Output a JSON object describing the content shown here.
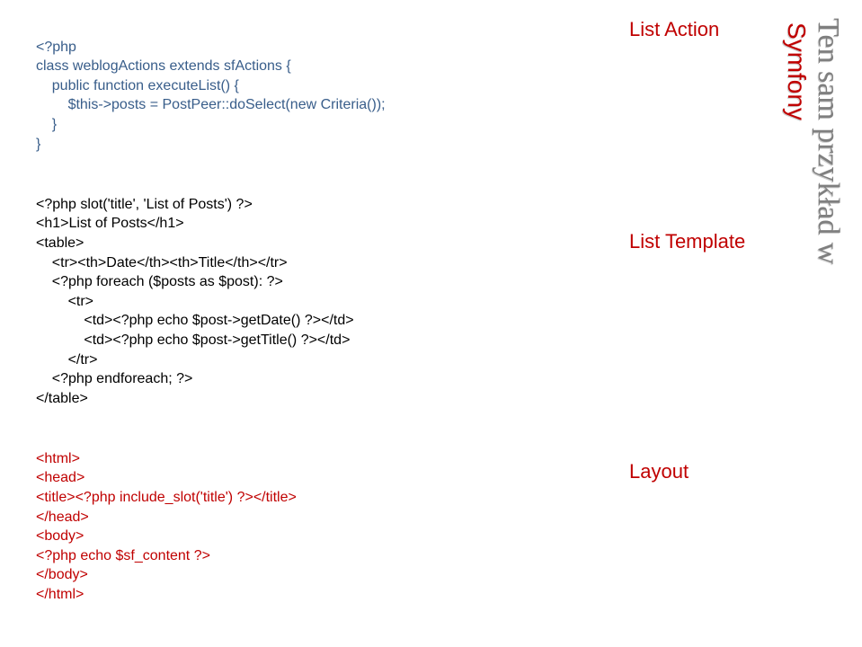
{
  "code": {
    "block1": {
      "l1": "<?php",
      "l2": "class weblogActions extends sfActions {",
      "l3": "    public function executeList() {",
      "l4": "        $this->posts = PostPeer::doSelect(new Criteria());",
      "l5": "    }",
      "l6": "}"
    },
    "block2": {
      "l1": "<?php slot('title', 'List of Posts') ?>",
      "l2": "<h1>List of Posts</h1>",
      "l3": "<table>",
      "l4": "    <tr><th>Date</th><th>Title</th></tr>",
      "l5": "    <?php foreach ($posts as $post): ?>",
      "l6": "        <tr>",
      "l7": "            <td><?php echo $post->getDate() ?></td>",
      "l8": "            <td><?php echo $post->getTitle() ?></td>",
      "l9": "        </tr>",
      "l10": "    <?php endforeach; ?>",
      "l11": "</table>"
    },
    "block3": {
      "l1": "<html>",
      "l2": "<head>",
      "l3": "<title><?php include_slot('title') ?></title>",
      "l4": "</head>",
      "l5": "<body>",
      "l6": "<?php echo $sf_content ?>",
      "l7": "</body>",
      "l8": "</html>"
    }
  },
  "labels": {
    "action": "List Action",
    "template": "List Template",
    "layout": "Layout"
  },
  "sidebar": {
    "framework": "Symfony",
    "title": "Ten sam przykład w"
  }
}
